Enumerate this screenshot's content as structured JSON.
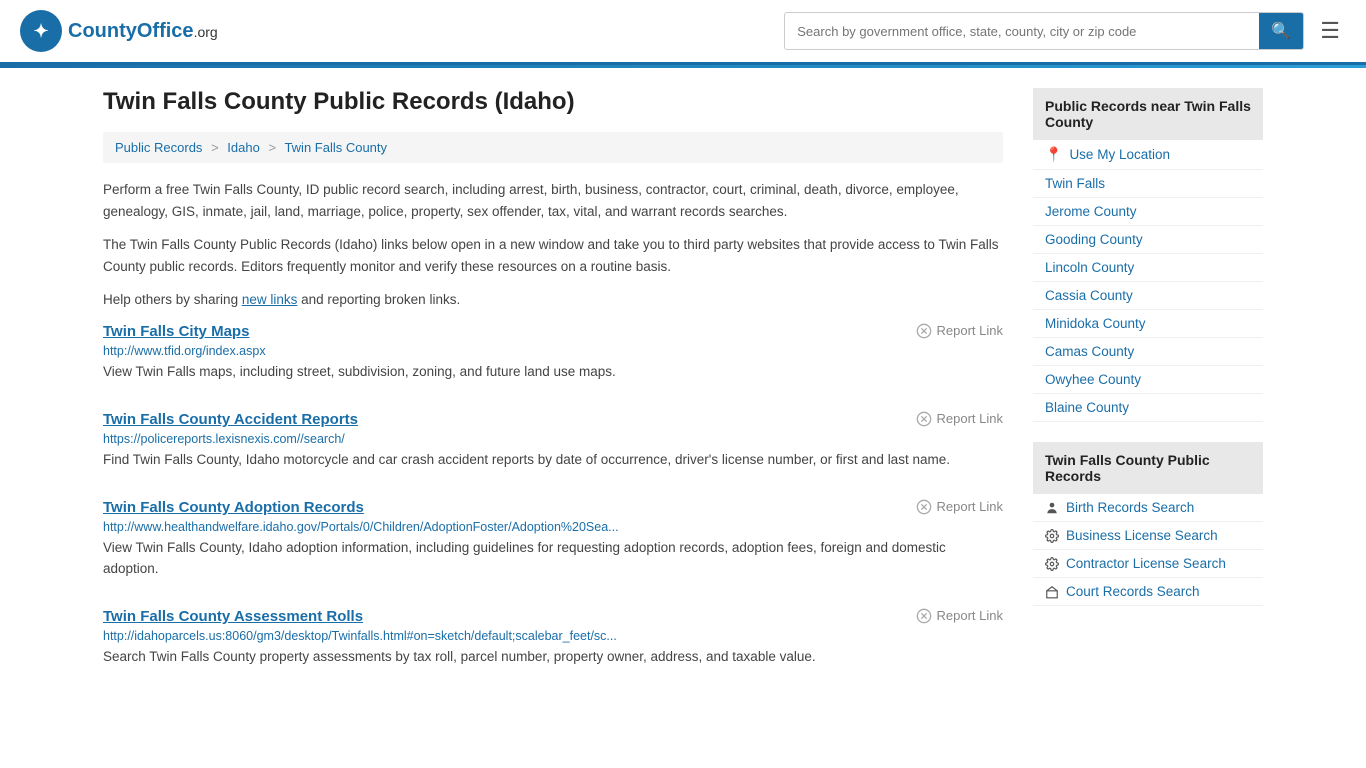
{
  "header": {
    "logo_symbol": "✦",
    "logo_main": "CountyOffice",
    "logo_suffix": ".org",
    "search_placeholder": "Search by government office, state, county, city or zip code"
  },
  "page": {
    "title": "Twin Falls County Public Records (Idaho)",
    "breadcrumb": [
      {
        "label": "Public Records",
        "href": "#"
      },
      {
        "label": "Idaho",
        "href": "#"
      },
      {
        "label": "Twin Falls County",
        "href": "#"
      }
    ],
    "description1": "Perform a free Twin Falls County, ID public record search, including arrest, birth, business, contractor, court, criminal, death, divorce, employee, genealogy, GIS, inmate, jail, land, marriage, police, property, sex offender, tax, vital, and warrant records searches.",
    "description2": "The Twin Falls County Public Records (Idaho) links below open in a new window and take you to third party websites that provide access to Twin Falls County public records. Editors frequently monitor and verify these resources on a routine basis.",
    "description3_prefix": "Help others by sharing ",
    "description3_link": "new links",
    "description3_suffix": " and reporting broken links.",
    "records": [
      {
        "title": "Twin Falls City Maps",
        "url": "http://www.tfid.org/index.aspx",
        "description": "View Twin Falls maps, including street, subdivision, zoning, and future land use maps.",
        "report_label": "Report Link"
      },
      {
        "title": "Twin Falls County Accident Reports",
        "url": "https://policereports.lexisnexis.com//search/",
        "description": "Find Twin Falls County, Idaho motorcycle and car crash accident reports by date of occurrence, driver's license number, or first and last name.",
        "report_label": "Report Link"
      },
      {
        "title": "Twin Falls County Adoption Records",
        "url": "http://www.healthandwelfare.idaho.gov/Portals/0/Children/AdoptionFoster/Adoption%20Sea...",
        "description": "View Twin Falls County, Idaho adoption information, including guidelines for requesting adoption records, adoption fees, foreign and domestic adoption.",
        "report_label": "Report Link"
      },
      {
        "title": "Twin Falls County Assessment Rolls",
        "url": "http://idahoparcels.us:8060/gm3/desktop/Twinfalls.html#on=sketch/default;scalebar_feet/sc...",
        "description": "Search Twin Falls County property assessments by tax roll, parcel number, property owner, address, and taxable value.",
        "report_label": "Report Link"
      }
    ]
  },
  "sidebar": {
    "nearby_header": "Public Records near Twin Falls County",
    "use_my_location": "Use My Location",
    "nearby_items": [
      {
        "label": "Twin Falls",
        "href": "#"
      },
      {
        "label": "Jerome County",
        "href": "#"
      },
      {
        "label": "Gooding County",
        "href": "#"
      },
      {
        "label": "Lincoln County",
        "href": "#"
      },
      {
        "label": "Cassia County",
        "href": "#"
      },
      {
        "label": "Minidoka County",
        "href": "#"
      },
      {
        "label": "Camas County",
        "href": "#"
      },
      {
        "label": "Owyhee County",
        "href": "#"
      },
      {
        "label": "Blaine County",
        "href": "#"
      }
    ],
    "records_header": "Twin Falls County Public Records",
    "records_items": [
      {
        "label": "Birth Records Search",
        "href": "#",
        "icon": "person"
      },
      {
        "label": "Business License Search",
        "href": "#",
        "icon": "gear"
      },
      {
        "label": "Contractor License Search",
        "href": "#",
        "icon": "gear"
      },
      {
        "label": "Court Records Search",
        "href": "#",
        "icon": "building"
      }
    ]
  }
}
